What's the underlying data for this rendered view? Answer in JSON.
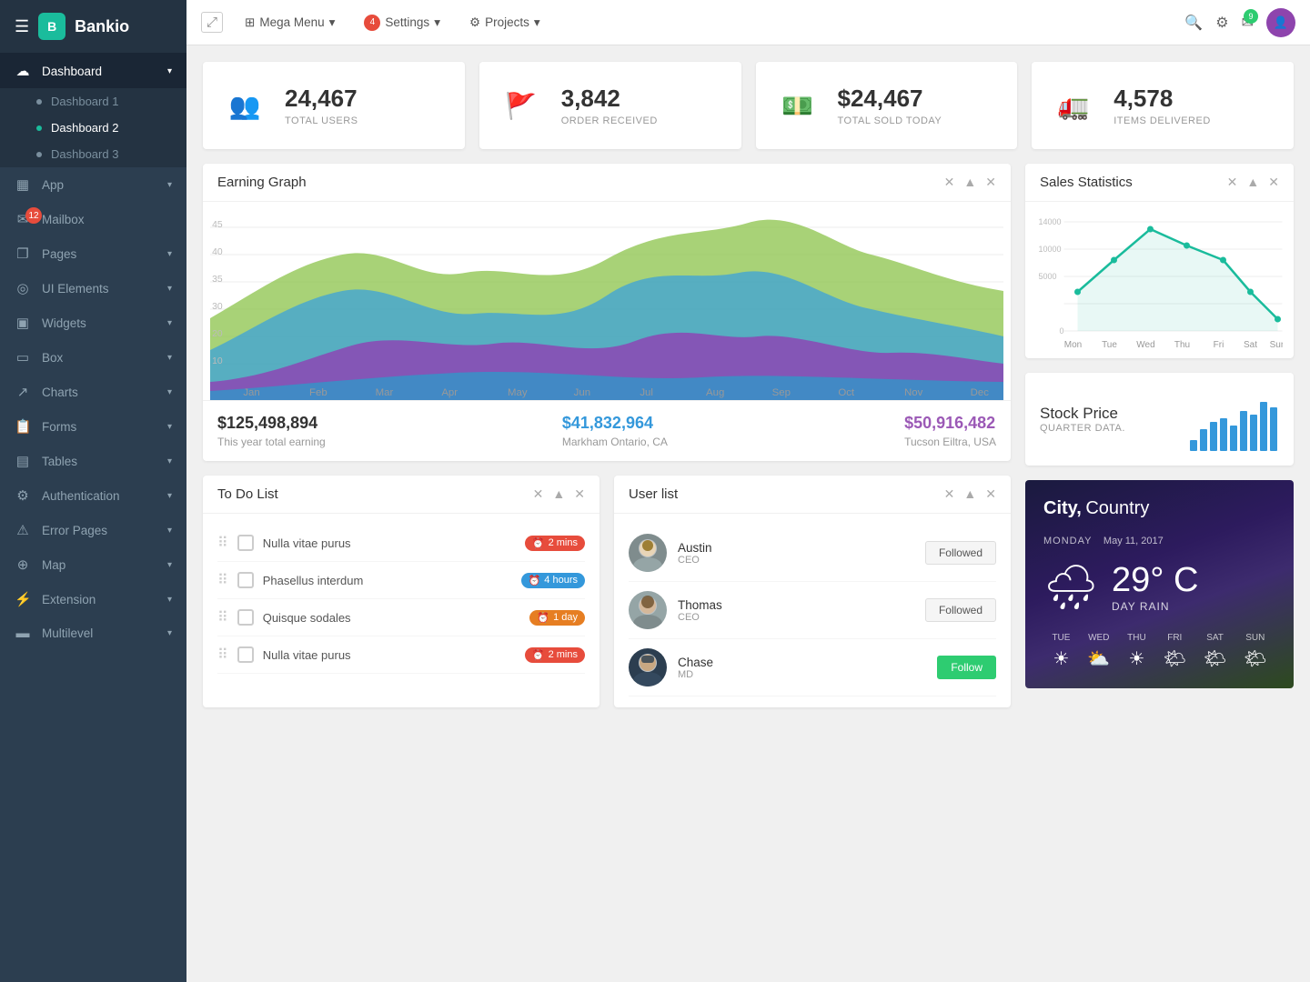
{
  "brand": "Bankio",
  "nav": {
    "fullscreen": "⤢",
    "megamenu": "Mega Menu",
    "settings": "Settings",
    "settings_badge": "4",
    "projects": "Projects"
  },
  "sidebar": {
    "items": [
      {
        "id": "dashboard",
        "label": "Dashboard",
        "icon": "☁",
        "hasArrow": true,
        "expanded": true
      },
      {
        "id": "app",
        "label": "App",
        "icon": "▦",
        "hasArrow": true
      },
      {
        "id": "mailbox",
        "label": "Mailbox",
        "icon": "✉",
        "hasArrow": false,
        "badge": "12"
      },
      {
        "id": "pages",
        "label": "Pages",
        "icon": "❐",
        "hasArrow": true
      },
      {
        "id": "ui-elements",
        "label": "UI Elements",
        "icon": "◎",
        "hasArrow": true
      },
      {
        "id": "widgets",
        "label": "Widgets",
        "icon": "▣",
        "hasArrow": true
      },
      {
        "id": "box",
        "label": "Box",
        "icon": "▭",
        "hasArrow": true
      },
      {
        "id": "charts",
        "label": "Charts",
        "icon": "↗",
        "hasArrow": true
      },
      {
        "id": "forms",
        "label": "Forms",
        "icon": "📋",
        "hasArrow": true
      },
      {
        "id": "tables",
        "label": "Tables",
        "icon": "▤",
        "hasArrow": true
      },
      {
        "id": "authentication",
        "label": "Authentication",
        "icon": "⚙",
        "hasArrow": true
      },
      {
        "id": "error-pages",
        "label": "Error Pages",
        "icon": "⚠",
        "hasArrow": true
      },
      {
        "id": "map",
        "label": "Map",
        "icon": "⊕",
        "hasArrow": true
      },
      {
        "id": "extension",
        "label": "Extension",
        "icon": "⚡",
        "hasArrow": true
      },
      {
        "id": "multilevel",
        "label": "Multilevel",
        "icon": "▬",
        "hasArrow": true
      }
    ],
    "dashboard_subs": [
      {
        "label": "Dashboard 1",
        "active": false
      },
      {
        "label": "Dashboard 2",
        "active": true
      },
      {
        "label": "Dashboard 3",
        "active": false
      }
    ]
  },
  "stats": [
    {
      "icon": "👥",
      "icon_color": "#e74c3c",
      "value": "24,467",
      "label": "TOTAL USERS"
    },
    {
      "icon": "🚩",
      "icon_color": "#3498db",
      "value": "3,842",
      "label": "ORDER RECEIVED"
    },
    {
      "icon": "💵",
      "icon_color": "#2ecc71",
      "value": "$24,467",
      "label": "TOTAL SOLD TODAY"
    },
    {
      "icon": "🚛",
      "icon_color": "#e67e22",
      "value": "4,578",
      "label": "ITEMS DELIVERED"
    }
  ],
  "earning_graph": {
    "title": "Earning Graph",
    "stat1_value": "$125,498,894",
    "stat1_label": "This year total earning",
    "stat2_value": "$41,832,964",
    "stat2_label": "Markham Ontario, CA",
    "stat3_value": "$50,916,482",
    "stat3_label": "Tucson Eiltra, USA",
    "months": [
      "Jan",
      "Feb",
      "Mar",
      "Apr",
      "May",
      "Jun",
      "Jul",
      "Aug",
      "Sep",
      "Oct",
      "Nov",
      "Dec"
    ]
  },
  "sales_statistics": {
    "title": "Sales Statistics",
    "days": [
      "Mon",
      "Tue",
      "Wed",
      "Thu",
      "Fri",
      "Sat",
      "Sun"
    ],
    "values": [
      5000,
      9000,
      13000,
      11000,
      9000,
      5000,
      1500
    ]
  },
  "stock_price": {
    "title": "Stock Price",
    "subtitle": "QUARTER DATA.",
    "bars": [
      30,
      45,
      55,
      60,
      50,
      70,
      65,
      80,
      75,
      90
    ]
  },
  "todo": {
    "title": "To Do List",
    "items": [
      {
        "text": "Nulla vitae purus",
        "badge": "2 mins",
        "badge_type": "red",
        "badge_icon": "⏰"
      },
      {
        "text": "Phasellus interdum",
        "badge": "4 hours",
        "badge_type": "blue",
        "badge_icon": "⏰"
      },
      {
        "text": "Quisque sodales",
        "badge": "1 day",
        "badge_type": "orange",
        "badge_icon": "⏰"
      },
      {
        "text": "Nulla vitae purus",
        "badge": "2 mins",
        "badge_type": "red",
        "badge_icon": "⏰"
      }
    ]
  },
  "user_list": {
    "title": "User list",
    "users": [
      {
        "name": "Austin",
        "role": "CEO",
        "action": "Followed",
        "action_type": "followed"
      },
      {
        "name": "Thomas",
        "role": "CEO",
        "action": "Followed",
        "action_type": "followed"
      },
      {
        "name": "Chase",
        "role": "MD",
        "action": "Follow",
        "action_type": "follow"
      }
    ]
  },
  "weather": {
    "city": "City,",
    "country": "Country",
    "date_day": "MONDAY",
    "date": "May 11, 2017",
    "temp": "29° C",
    "description": "DAY RAIN",
    "forecast": [
      {
        "day": "TUE",
        "icon": "☀"
      },
      {
        "day": "WED",
        "icon": "⛅"
      },
      {
        "day": "THU",
        "icon": "☀"
      },
      {
        "day": "FRI",
        "icon": "🌤"
      },
      {
        "day": "SAT",
        "icon": "🌤"
      },
      {
        "day": "SUN",
        "icon": "🌤"
      }
    ]
  }
}
